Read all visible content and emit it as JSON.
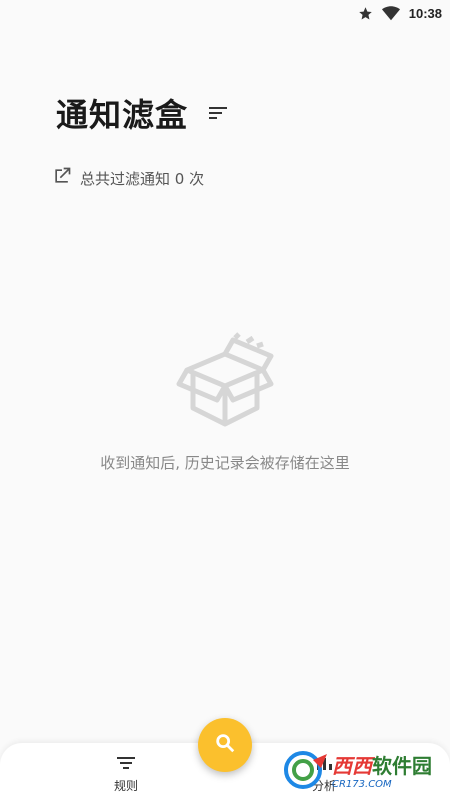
{
  "status_bar": {
    "time": "10:38",
    "icons": [
      "star-icon",
      "wifi-icon",
      "battery-icon"
    ]
  },
  "header": {
    "title": "通知滤盒",
    "sort_icon": "sort-icon"
  },
  "summary": {
    "text": "总共过滤通知 0 次",
    "icon": "open-in-new-icon"
  },
  "empty_state": {
    "icon": "empty-box-icon",
    "message": "收到通知后, 历史记录会被存储在这里"
  },
  "bottom_nav": {
    "items": [
      {
        "label": "规则",
        "icon": "filter-list-icon"
      },
      {
        "label": "分析",
        "icon": "analytics-icon"
      }
    ],
    "fab_icon": "search-icon"
  },
  "watermark": {
    "brand": "西西",
    "suffix": "软件园",
    "url": "CR173.COM"
  },
  "colors": {
    "accent": "#fbc02d",
    "background": "#fafafa",
    "text_primary": "#1a1a1a",
    "text_secondary": "#888888"
  }
}
